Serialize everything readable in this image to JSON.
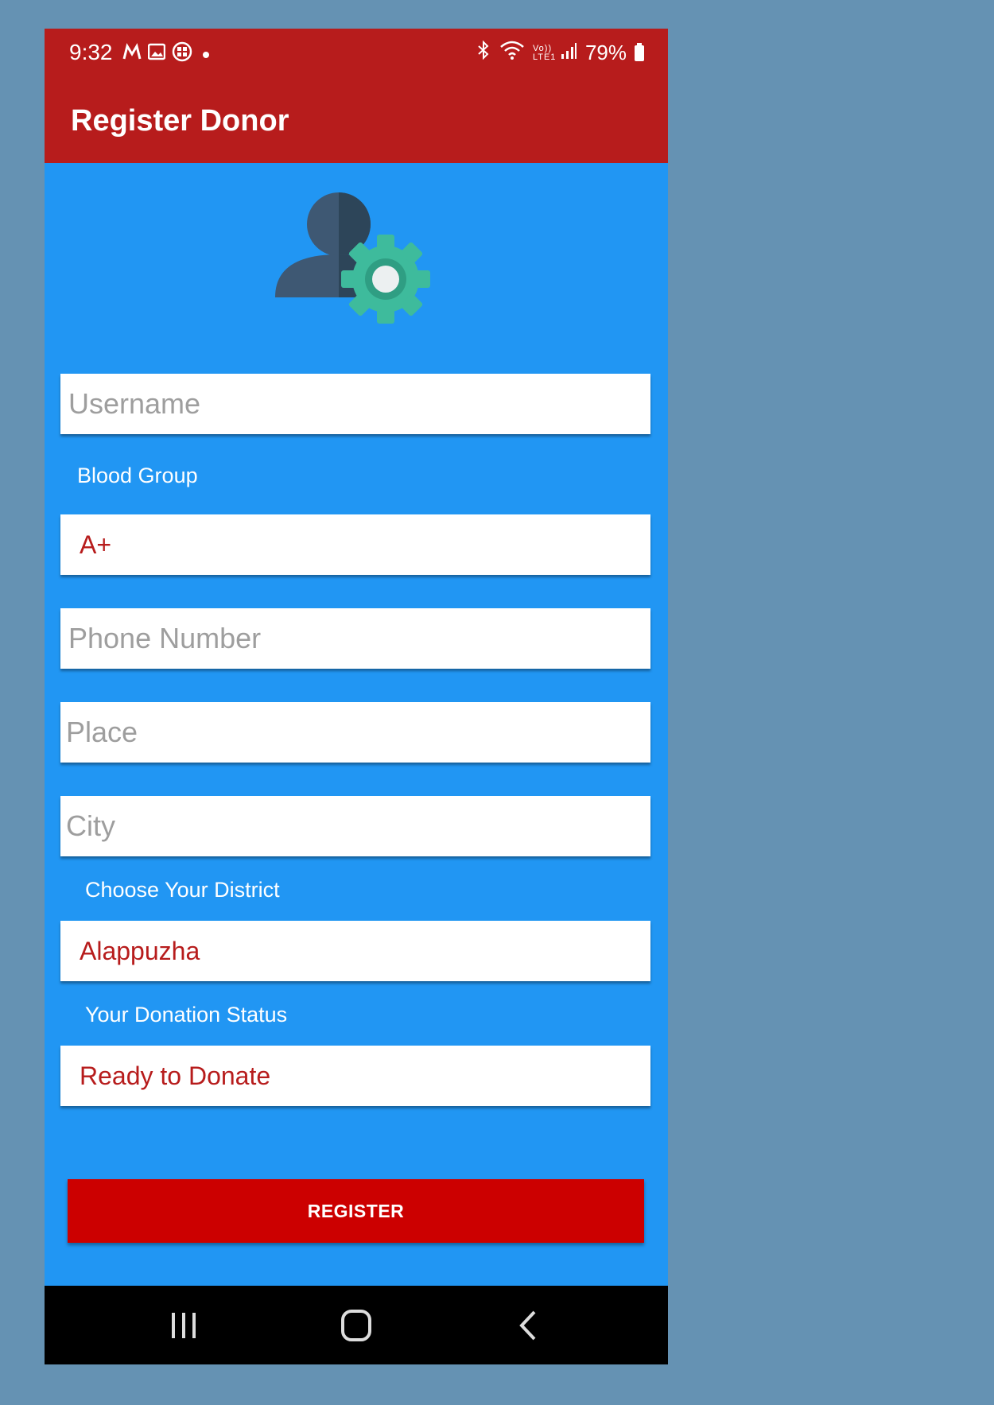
{
  "status_bar": {
    "time": "9:32",
    "battery": "79%",
    "icons": [
      "m-app-icon",
      "gallery-icon",
      "app-icon",
      "dot-icon",
      "bluetooth-icon",
      "wifi-icon",
      "volte-icon",
      "signal-icon",
      "battery-icon"
    ],
    "volte_text": "Vo)) LTE1"
  },
  "app_bar": {
    "title": "Register Donor"
  },
  "form": {
    "username_placeholder": "Username",
    "blood_group_label": "Blood Group",
    "blood_group_value": "A+",
    "phone_placeholder": "Phone Number",
    "place_placeholder": "Place",
    "city_placeholder": "City",
    "district_label": "Choose Your District",
    "district_value": "Alappuzha",
    "status_label": "Your Donation Status",
    "status_value": "Ready to Donate",
    "register_label": "REGISTER"
  },
  "colors": {
    "app_bar": "#b71c1c",
    "background": "#2196f3",
    "button": "#cc0000",
    "select_text": "#b71c1c",
    "outer_background": "#6592b3"
  },
  "nav_bar": {
    "buttons": [
      "recents-icon",
      "home-icon",
      "back-icon"
    ]
  }
}
